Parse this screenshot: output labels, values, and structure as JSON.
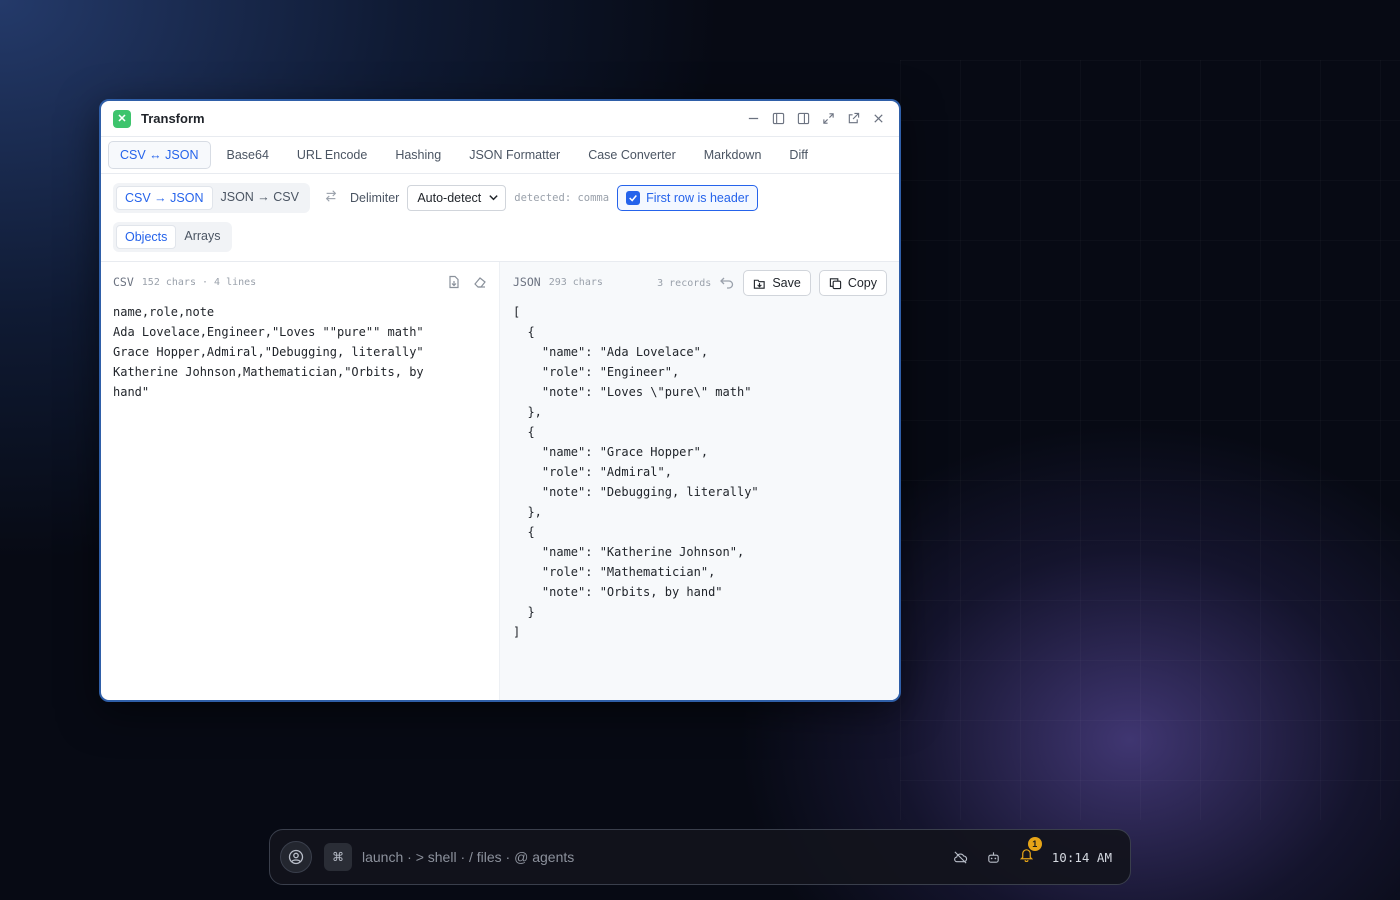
{
  "window": {
    "title": "Transform",
    "controls": [
      "minimize-icon",
      "sidebar-left-icon",
      "sidebar-right-icon",
      "expand-icon",
      "popout-icon",
      "close-icon"
    ]
  },
  "tabs": [
    "CSV ↔ JSON",
    "Base64",
    "URL Encode",
    "Hashing",
    "JSON Formatter",
    "Case Converter",
    "Markdown",
    "Diff"
  ],
  "toolbar": {
    "mode_csv_to_json": "CSV → JSON",
    "mode_json_to_csv": "JSON → CSV",
    "delimiter_label": "Delimiter",
    "delimiter_value": "Auto-detect",
    "detected_hint": "detected: comma",
    "header_toggle_label": "First row is header",
    "header_toggle_checked": true,
    "output_objects": "Objects",
    "output_arrays": "Arrays"
  },
  "left_pane": {
    "name": "CSV",
    "meta": "152 chars · 4 lines",
    "content": "name,role,note\nAda Lovelace,Engineer,\"Loves \"\"pure\"\" math\"\nGrace Hopper,Admiral,\"Debugging, literally\"\nKatherine Johnson,Mathematician,\"Orbits, by\nhand\""
  },
  "right_pane": {
    "name": "JSON",
    "meta": "293 chars",
    "records": "3 records",
    "save_label": "Save",
    "copy_label": "Copy",
    "content": "[\n  {\n    \"name\": \"Ada Lovelace\",\n    \"role\": \"Engineer\",\n    \"note\": \"Loves \\\"pure\\\" math\"\n  },\n  {\n    \"name\": \"Grace Hopper\",\n    \"role\": \"Admiral\",\n    \"note\": \"Debugging, literally\"\n  },\n  {\n    \"name\": \"Katherine Johnson\",\n    \"role\": \"Mathematician\",\n    \"note\": \"Orbits, by hand\"\n  }\n]"
  },
  "dock": {
    "key_glyph": "⌘",
    "launcher_text": "launch · > shell · / files · @ agents",
    "notification_count": "1",
    "clock": "10:14 AM"
  },
  "colors": {
    "accent": "#2563eb",
    "app_icon": "#3ec46d",
    "badge": "#e6a417"
  }
}
